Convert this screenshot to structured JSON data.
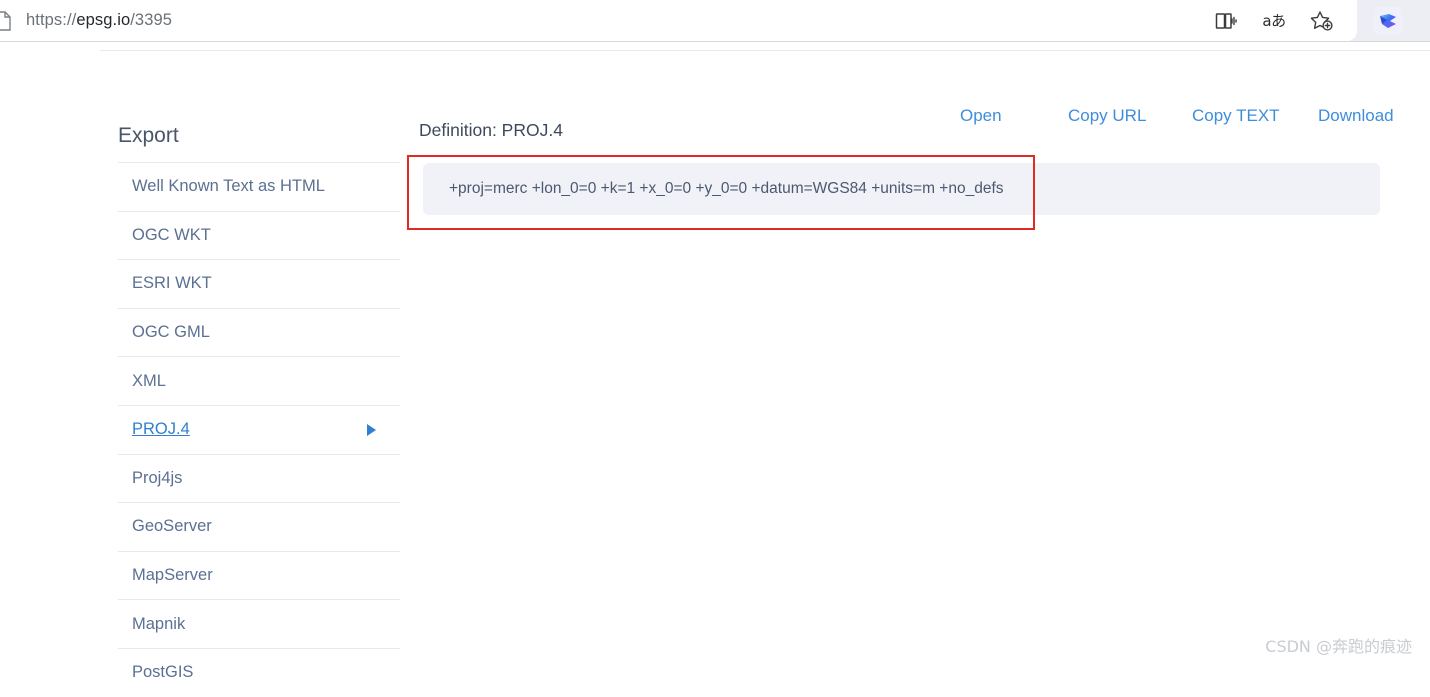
{
  "browser": {
    "url_scheme": "https://",
    "url_host": "epsg.io",
    "url_path": "/3395",
    "favicon": "page-document-icon",
    "actions": [
      {
        "name": "read-aloud-icon",
        "glyph": "read-aloud"
      },
      {
        "name": "translate-icon",
        "glyph": "aあ"
      },
      {
        "name": "add-favorite-icon",
        "glyph": "star-plus"
      }
    ],
    "extension": {
      "name": "browser-extension-icon",
      "glyph": "bird"
    }
  },
  "sidebar": {
    "title": "Export",
    "items": [
      {
        "label": "Well Known Text as HTML",
        "active": false
      },
      {
        "label": "OGC WKT",
        "active": false
      },
      {
        "label": "ESRI WKT",
        "active": false
      },
      {
        "label": "OGC GML",
        "active": false
      },
      {
        "label": "XML",
        "active": false
      },
      {
        "label": "PROJ.4",
        "active": true
      },
      {
        "label": "Proj4js",
        "active": false
      },
      {
        "label": "GeoServer",
        "active": false
      },
      {
        "label": "MapServer",
        "active": false
      },
      {
        "label": "Mapnik",
        "active": false
      },
      {
        "label": "PostGIS",
        "active": false
      }
    ]
  },
  "main": {
    "heading": "Definition: PROJ.4",
    "links": [
      {
        "label": "Open",
        "id": "link-open"
      },
      {
        "label": "Copy URL",
        "id": "link-copy-url"
      },
      {
        "label": "Copy TEXT",
        "id": "link-copy-text"
      },
      {
        "label": "Download",
        "id": "link-download"
      }
    ],
    "definition": "+proj=merc +lon_0=0 +k=1 +x_0=0 +y_0=0 +datum=WGS84 +units=m +no_defs"
  },
  "annotation": {
    "color": "#e02b20"
  },
  "watermark": "CSDN @奔跑的痕迹"
}
